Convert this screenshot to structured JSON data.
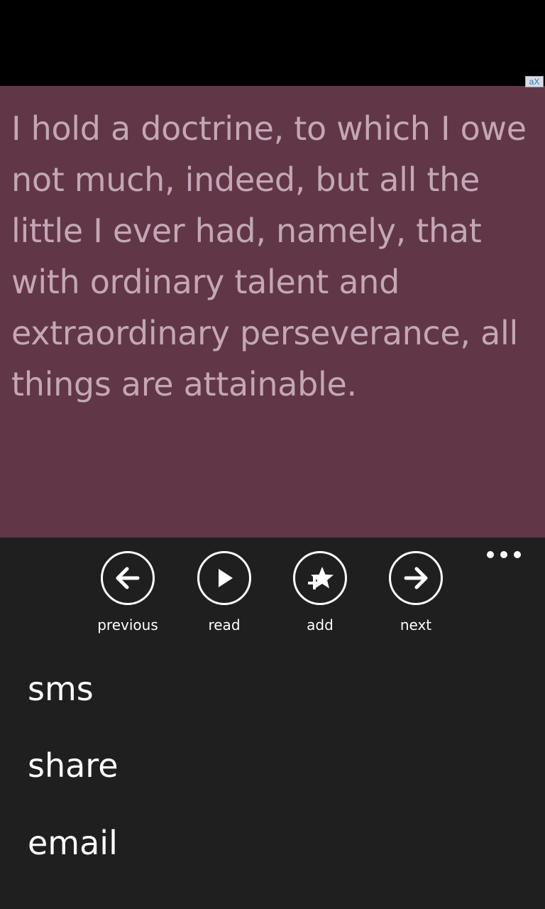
{
  "ad": {
    "badge_label": "aX"
  },
  "quote": {
    "text": "I hold a doctrine, to which I owe not much, indeed, but all the little I ever had, namely, that with ordinary talent and extraordinary perseverance, all things are attainable."
  },
  "app_bar": {
    "buttons": [
      {
        "label": "previous",
        "icon": "arrow-left-icon"
      },
      {
        "label": "read",
        "icon": "play-icon"
      },
      {
        "label": "add",
        "icon": "add-favorite-icon"
      },
      {
        "label": "next",
        "icon": "arrow-right-icon"
      }
    ],
    "menu_items": [
      {
        "label": "sms"
      },
      {
        "label": "share"
      },
      {
        "label": "email"
      }
    ]
  },
  "colors": {
    "quote_background": "#613646",
    "quote_text": "#c3a7b6",
    "app_bar_background": "#1f1f1f",
    "foreground": "#ffffff"
  }
}
